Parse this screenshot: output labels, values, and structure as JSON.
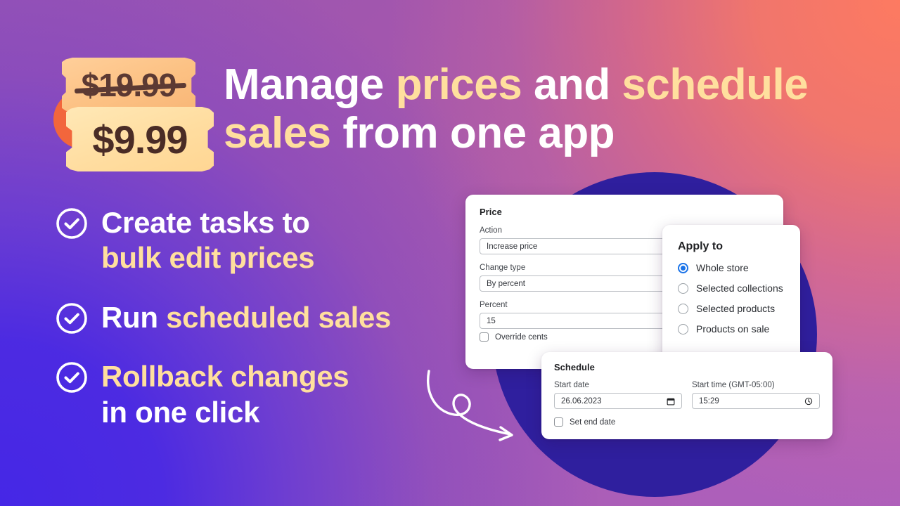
{
  "theme": {
    "bg_top_left": "#9a55b2",
    "bg_top_right": "#fd7a61",
    "bg_bottom_left": "#4527e6",
    "bg_bottom_right": "#ae5fbb",
    "circle": "#2f1f9e",
    "accent_cream": "#ffdf9e",
    "radio_blue": "#1a73e8",
    "tag_old": "#fcc183",
    "tag_new": "#ffdda0",
    "tag_text": "#5c3a33"
  },
  "price_tags": {
    "old_price": "$19.99",
    "new_price": "$9.99"
  },
  "headline": {
    "line1_part1": "Manage ",
    "line1_part2": "prices",
    "line1_part3": " and ",
    "line1_part4": "schedule",
    "line2_part1": "sales",
    "line2_part2": " from one app"
  },
  "features": [
    {
      "icon": "check-circle-icon",
      "plain_1": "Create tasks to",
      "accent_1": "bulk edit prices"
    },
    {
      "icon": "check-circle-icon",
      "plain_1": "Run ",
      "accent_1": "scheduled sales"
    },
    {
      "icon": "check-circle-icon",
      "accent_1": "Rollback changes",
      "plain_1": "in one click"
    }
  ],
  "decor": {
    "arrow": "curved-arrow-icon"
  },
  "price_card": {
    "title": "Price",
    "action": {
      "label": "Action",
      "value": "Increase price"
    },
    "change_type": {
      "label": "Change type",
      "value": "By percent"
    },
    "percent": {
      "label": "Percent",
      "value": "15"
    },
    "override_cents": {
      "label": "Override cents",
      "checked": false
    }
  },
  "apply_card": {
    "title": "Apply to",
    "options": [
      {
        "label": "Whole store",
        "selected": true
      },
      {
        "label": "Selected collections",
        "selected": false
      },
      {
        "label": "Selected products",
        "selected": false
      },
      {
        "label": "Products on sale",
        "selected": false
      }
    ]
  },
  "schedule_card": {
    "title": "Schedule",
    "start_date": {
      "label": "Start date",
      "value": "26.06.2023",
      "icon": "calendar-icon"
    },
    "start_time": {
      "label": "Start time (GMT-05:00)",
      "value": "15:29",
      "icon": "clock-icon"
    },
    "set_end_date": {
      "label": "Set end date",
      "checked": false
    }
  }
}
